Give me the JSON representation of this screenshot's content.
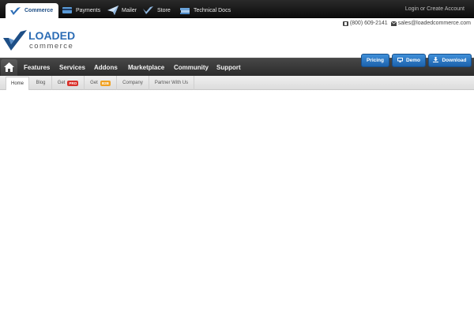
{
  "topbar": {
    "tabs": [
      {
        "label": "Commerce",
        "icon": "loaded-logo-icon",
        "active": true
      },
      {
        "label": "Payments",
        "icon": "credit-card-icon",
        "active": false
      },
      {
        "label": "Mailer",
        "icon": "paper-plane-icon",
        "active": false
      },
      {
        "label": "Store",
        "icon": "store-icon",
        "active": false
      },
      {
        "label": "Technical Docs",
        "icon": "books-icon",
        "active": false
      }
    ],
    "login_label": "Login",
    "or_label": "or",
    "create_account_label": "Create Account"
  },
  "header": {
    "logo_main": "LOADED",
    "logo_sub": "commerce",
    "phone": "(800) 609-2141",
    "email": "sales@loadedcommerce.com"
  },
  "actions": {
    "pricing": "Pricing",
    "demo": "Demo",
    "download": "Download"
  },
  "mainnav": {
    "home_icon": "home-icon",
    "items": [
      "Features",
      "Services",
      "Addons",
      "Marketplace",
      "Community",
      "Support"
    ]
  },
  "subnav": {
    "items": [
      {
        "label": "Home",
        "active": true
      },
      {
        "label": "Blog"
      },
      {
        "label": "Get",
        "badge": "PRO",
        "badge_color": "#d9302a"
      },
      {
        "label": "Get",
        "badge": "B2B",
        "badge_color": "#f0a020"
      },
      {
        "label": "Company"
      },
      {
        "label": "Partner With Us"
      }
    ]
  },
  "colors": {
    "brand_blue": "#1d4e86",
    "button_blue": "#2a74c2",
    "nav_dark": "#333333"
  }
}
